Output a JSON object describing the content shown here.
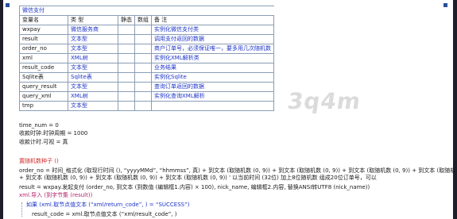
{
  "table": {
    "title": "微信支付",
    "headers": [
      "变量名",
      "类 型",
      "静态",
      "数组",
      "备 注"
    ],
    "rows": [
      {
        "name": "wxpay",
        "type": "微信服务商",
        "static": "",
        "array": "",
        "note": "实例化微信支付类"
      },
      {
        "name": "result",
        "type": "文本型",
        "static": "",
        "array": "",
        "note": "调用支付返回的数据"
      },
      {
        "name": "order_no",
        "type": "文本型",
        "static": "",
        "array": "",
        "note": "商户订单号，必须保证唯一，要多用几次随机数"
      },
      {
        "name": "xml",
        "type": "XML树",
        "static": "",
        "array": "",
        "note": "实例化XML解析类"
      },
      {
        "name": "result_code",
        "type": "文本型",
        "static": "",
        "array": "",
        "note": "业务结果"
      },
      {
        "name": "Sqlite表",
        "type": "Sqlite表",
        "static": "",
        "array": "",
        "note": "实例化Sqlite"
      },
      {
        "name": "query_result",
        "type": "文本型",
        "static": "",
        "array": "",
        "note": "查询订单返回的数据"
      },
      {
        "name": "query_xml",
        "type": "XML树",
        "static": "",
        "array": "",
        "note": "实例化查询XML解析"
      },
      {
        "name": "tmp",
        "type": "文本型",
        "static": "",
        "array": "",
        "note": ""
      }
    ]
  },
  "code": {
    "line1": "time_num = 0",
    "line2": "收款时钟.时钟周期 = 1000",
    "line3": "收款计时.可视 = 真",
    "line4": "置随机数种子 ()",
    "line5": "order_no = 时间_格式化 (取现行时间 (), “yyyyMMd”, “hhmmss”, 真) + 到文本 (取随机数 (0, 9)) + 到文本 (取随机数 (0, 9)) + 到文本 (取随机数 (0, 9)) + 到文本 (取随机",
    "line6": "+ 到文本 (取随机数 (0, 9)) + 到文本 (取随机数 (0, 9)) + 到文本 (取随机数 (0, 9))  ' 以当前时间 (32位) 加上8位随机数 组成20位订单号，可以",
    "line7": "result = wxpay.发起支付 (order_no, 到文本 (到数值 (编辑框1.内容) × 100), nick_name, 编辑框2.内容, 替换ANSI转UTF8 (nick_name))",
    "line8": "xml.导入 (到字节集 (result))",
    "line9": "如果 (xml.取节点值文本 (“xml/return_code”, ) = “SUCCESS”)",
    "line10": "result_code = xml.取节点值文本 (“xml/result_code”, )"
  },
  "watermark": "3q4m"
}
